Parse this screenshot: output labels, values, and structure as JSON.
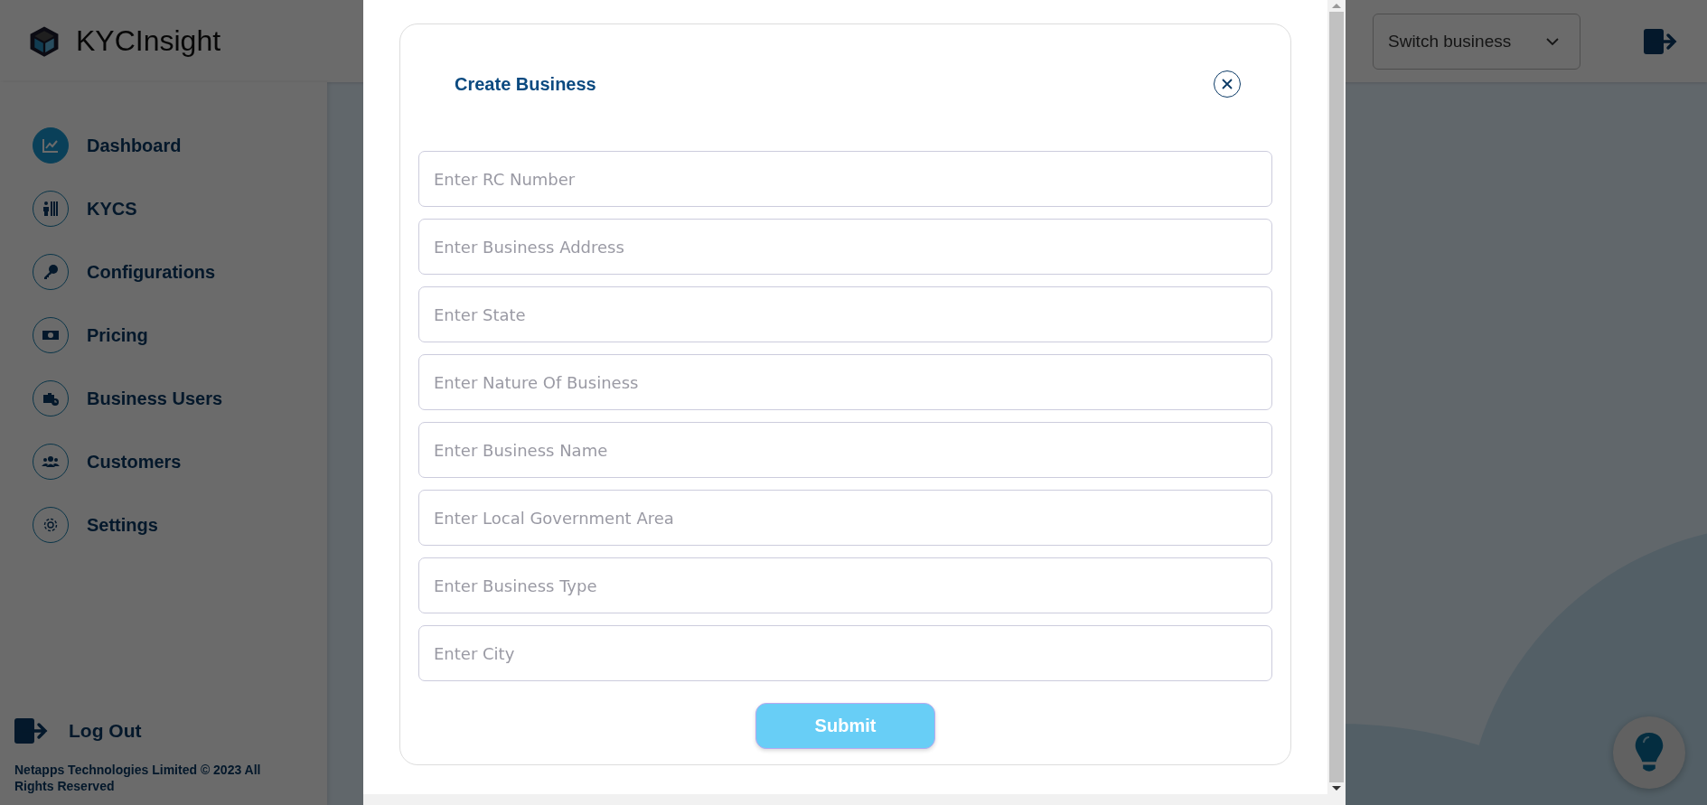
{
  "brand": {
    "name": "KYCInsight"
  },
  "header": {
    "switch_business": {
      "placeholder": "Switch business"
    }
  },
  "sidebar": {
    "items": [
      {
        "label": "Dashboard",
        "selected": true
      },
      {
        "label": "KYCS",
        "selected": false
      },
      {
        "label": "Configurations",
        "selected": false
      },
      {
        "label": "Pricing",
        "selected": false
      },
      {
        "label": "Business Users",
        "selected": false
      },
      {
        "label": "Customers",
        "selected": false
      },
      {
        "label": "Settings",
        "selected": false
      }
    ],
    "logout": "Log Out",
    "footer": "Netapps Technologies Limited © 2023 All Rights Reserved"
  },
  "modal": {
    "title": "Create Business",
    "fields": [
      {
        "placeholder": "Enter RC Number"
      },
      {
        "placeholder": "Enter Business Address"
      },
      {
        "placeholder": "Enter State"
      },
      {
        "placeholder": "Enter Nature Of Business"
      },
      {
        "placeholder": "Enter Business Name"
      },
      {
        "placeholder": "Enter Local Government Area"
      },
      {
        "placeholder": "Enter Business Type"
      },
      {
        "placeholder": "Enter City"
      }
    ],
    "submit": "Submit"
  }
}
